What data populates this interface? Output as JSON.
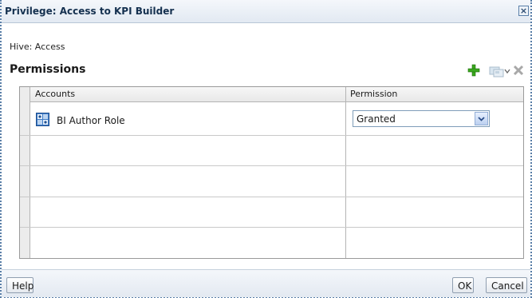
{
  "dialog": {
    "title": "Privilege: Access to KPI Builder",
    "close_glyph": "×"
  },
  "hive": {
    "label": "Hive: Access"
  },
  "permissions": {
    "title": "Permissions",
    "toolbar": {
      "add_icon": "add-icon",
      "view_icon": "view-members-icon",
      "dropdown_icon": "chevron-down-icon",
      "delete_icon": "delete-icon"
    },
    "columns": {
      "accounts": "Accounts",
      "permission": "Permission"
    },
    "rows": [
      {
        "account": "BI Author Role",
        "permission": "Granted",
        "icon": "application-role-icon"
      }
    ]
  },
  "footer": {
    "help": "Help",
    "ok": "OK",
    "cancel": "Cancel"
  },
  "colors": {
    "add_green": "#3aa81e",
    "title_text": "#14304f",
    "border_blue": "#5a7fa8"
  }
}
